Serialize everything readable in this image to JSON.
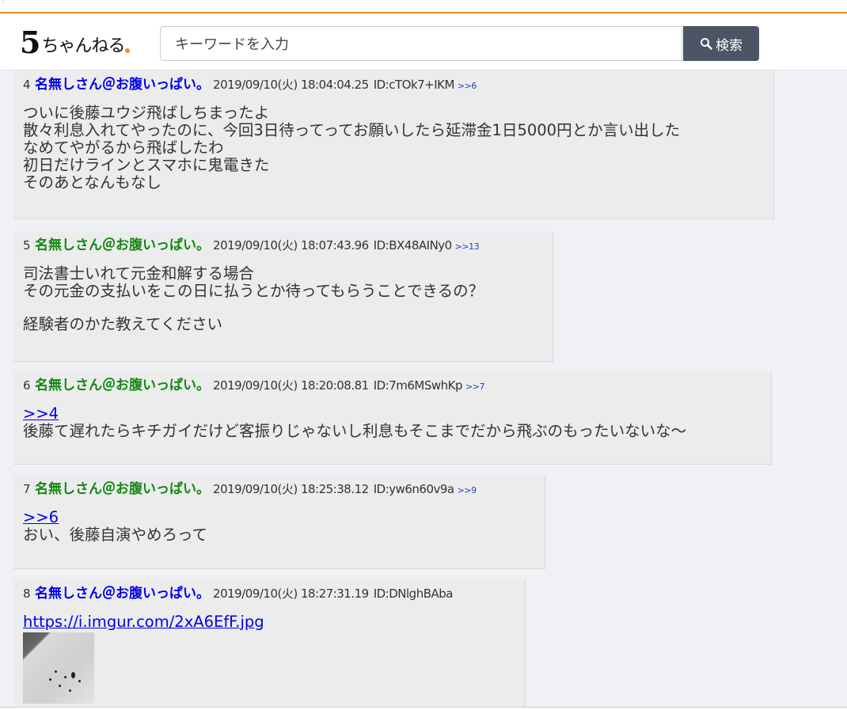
{
  "header": {
    "logo_main": "5",
    "logo_text": "ちゃんねる",
    "search_placeholder": "キーワードを入力",
    "search_button": "検索",
    "accent_color": "#f08b2c"
  },
  "posts": [
    {
      "num": "4",
      "name": "名無しさん＠お腹いっぱい。",
      "date": "2019/09/10(火) 18:04:04.25",
      "id": "ID:cTOk7+IKM",
      "reply": ">>6",
      "lines": [
        "ついに後藤ユウジ飛ばしちまったよ",
        "散々利息入れてやったのに、今回3日待ってってお願いしたら延滞金1日5000円とか言い出した",
        "なめてやがるから飛ばしたわ",
        "初日だけラインとスマホに鬼電きた",
        "そのあとなんもなし"
      ]
    },
    {
      "num": "5",
      "name": "名無しさん＠お腹いっぱい。",
      "date": "2019/09/10(火) 18:07:43.96",
      "id": "ID:BX48AINy0",
      "reply": ">>13",
      "lines": [
        "司法書士いれて元金和解する場合",
        "その元金の支払いをこの日に払うとか待ってもらうことできるの？",
        "経験者のかた教えてください"
      ]
    },
    {
      "num": "6",
      "name": "名無しさん＠お腹いっぱい。",
      "date": "2019/09/10(火) 18:20:08.81",
      "id": "ID:7m6MSwhKp",
      "reply": ">>7",
      "anchor": ">>4",
      "lines": [
        "後藤て遅れたらキチガイだけど客振りじゃないし利息もそこまでだから飛ぶのもったいないな〜"
      ]
    },
    {
      "num": "7",
      "name": "名無しさん＠お腹いっぱい。",
      "date": "2019/09/10(火) 18:25:38.12",
      "id": "ID:yw6n60v9a",
      "reply": ">>9",
      "anchor": ">>6",
      "lines": [
        "おい、後藤自演やめろって"
      ]
    },
    {
      "num": "8",
      "name": "名無しさん＠お腹いっぱい。",
      "date": "2019/09/10(火) 18:27:31.19",
      "id": "ID:DNlghBAba",
      "link": "https://i.imgur.com/2xA6EfF.jpg"
    }
  ],
  "colors": {
    "name_blue": "#0000ee",
    "name_green": "#118811",
    "post_bg": "#ececec",
    "page_bg": "#eff1f6"
  }
}
